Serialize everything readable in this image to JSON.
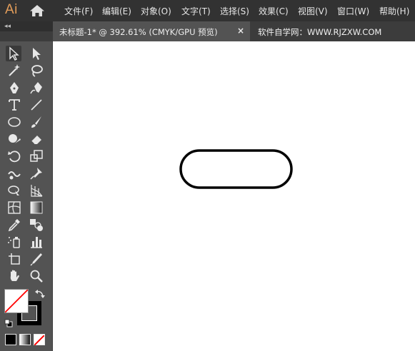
{
  "app": {
    "logo_text": "Ai"
  },
  "menu": {
    "items": [
      {
        "id": "file",
        "label": "文件(F)"
      },
      {
        "id": "edit",
        "label": "编辑(E)"
      },
      {
        "id": "object",
        "label": "对象(O)"
      },
      {
        "id": "type",
        "label": "文字(T)"
      },
      {
        "id": "select",
        "label": "选择(S)"
      },
      {
        "id": "effect",
        "label": "效果(C)"
      },
      {
        "id": "view",
        "label": "视图(V)"
      },
      {
        "id": "window",
        "label": "窗口(W)"
      },
      {
        "id": "help",
        "label": "帮助(H)"
      }
    ]
  },
  "document_tab": {
    "label": "未标题-1* @ 392.61% (CMYK/GPU 预览)",
    "close_symbol": "×",
    "watermark": "软件自学网：WWW.RJZXW.COM"
  },
  "toolbar": {
    "collapse_symbol": "◂◂",
    "tools": [
      "selection-tool-icon",
      "direct-selection-tool-icon",
      "magic-wand-tool-icon",
      "lasso-tool-icon",
      "pen-tool-icon",
      "curvature-tool-icon",
      "type-tool-icon",
      "line-segment-tool-icon",
      "ellipse-tool-icon",
      "paintbrush-tool-icon",
      "shaper-tool-icon",
      "eraser-tool-icon",
      "rotate-tool-icon",
      "scale-tool-icon",
      "warp-tool-icon",
      "puppet-warp-tool-icon",
      "shape-builder-tool-icon",
      "perspective-grid-tool-icon",
      "mesh-tool-icon",
      "gradient-tool-icon",
      "eyedropper-tool-icon",
      "blend-tool-icon",
      "symbol-sprayer-tool-icon",
      "column-graph-tool-icon",
      "artboard-tool-icon",
      "slice-tool-icon",
      "hand-tool-icon",
      "zoom-tool-icon"
    ],
    "fill": "none",
    "stroke": "#000000"
  },
  "canvas": {
    "shape": "rounded-rectangle-icon",
    "stroke_color": "#000000",
    "fill_color": "#ffffff"
  },
  "colors": {
    "menubar_bg": "#323232",
    "panel_bg": "#535353",
    "logo": "#e39d5a",
    "none_swatch_slash": "#ff0000"
  }
}
